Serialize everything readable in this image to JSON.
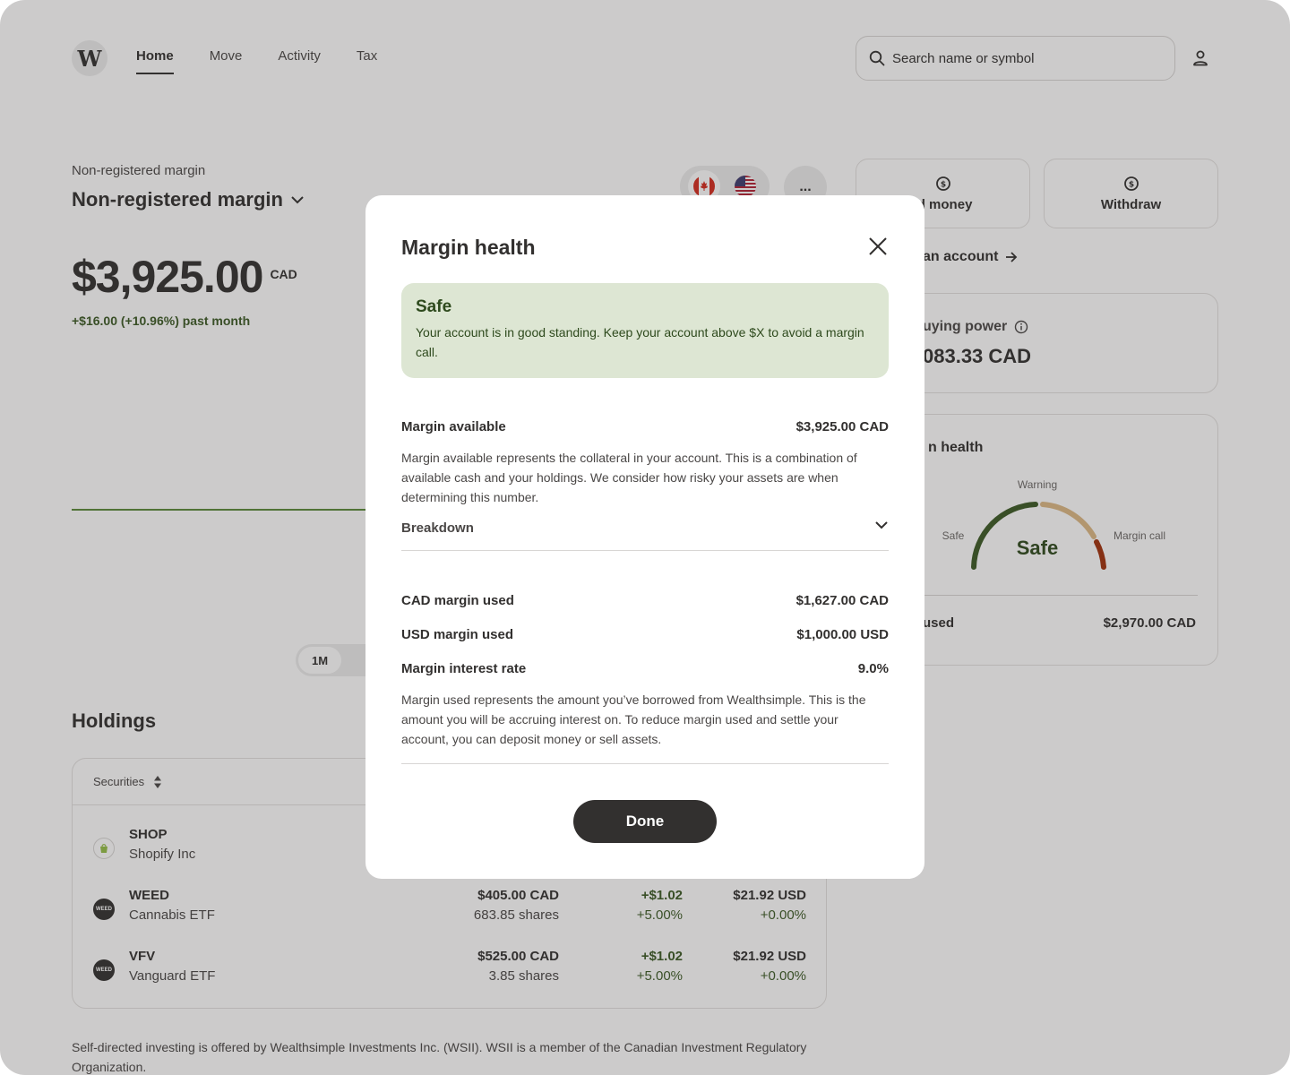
{
  "brand": {
    "logo_letter": "W"
  },
  "nav": {
    "items": [
      {
        "label": "Home",
        "active": true
      },
      {
        "label": "Move",
        "active": false
      },
      {
        "label": "Activity",
        "active": false
      },
      {
        "label": "Tax",
        "active": false
      }
    ]
  },
  "search": {
    "placeholder": "Search name or symbol"
  },
  "account": {
    "label": "Non-registered margin",
    "selected": "Non-registered margin",
    "balance": "$3,925.00",
    "currency": "CAD",
    "change": "+$16.00 (+10.96%) past month",
    "more_label": "..."
  },
  "chart": {
    "range_selected": "1M"
  },
  "holdings": {
    "title": "Holdings",
    "sort_label": "Securities",
    "rows": [
      {
        "symbol": "SHOP",
        "name": "Shopify Inc",
        "value": "",
        "shares": "",
        "change": "",
        "change_pct": "",
        "price": "",
        "price_pct": "",
        "logo_color": "#95BF47"
      },
      {
        "symbol": "WEED",
        "name": "Cannabis ETF",
        "value": "$405.00 CAD",
        "shares": "683.85 shares",
        "change": "+$1.02",
        "change_pct": "+5.00%",
        "price": "$21.92 USD",
        "price_pct": "+0.00%",
        "logo_text": "WEED",
        "logo_color": "#32302F"
      },
      {
        "symbol": "VFV",
        "name": "Vanguard ETF",
        "value": "$525.00 CAD",
        "shares": "3.85 shares",
        "change": "+$1.02",
        "change_pct": "+5.00%",
        "price": "$21.92 USD",
        "price_pct": "+0.00%",
        "logo_text": "WEED",
        "logo_color": "#32302F"
      }
    ]
  },
  "disclaimer": "Self-directed investing is offered by Wealthsimple Investments Inc. (WSII). WSII is a member of the Canadian Investment Regulatory Organization.",
  "right": {
    "add_money": "ld money",
    "withdraw": "Withdraw",
    "open_account": "an account",
    "buying_power_label": "uying power",
    "buying_power_value": "083.33 CAD",
    "margin_health_title": "n health",
    "gauge": {
      "safe": "Safe",
      "warning": "Warning",
      "margin_call": "Margin call",
      "status": "Safe",
      "level": 0.33
    },
    "used_label": "used",
    "used_value": "$2,970.00 CAD"
  },
  "modal": {
    "title": "Margin health",
    "status_title": "Safe",
    "status_text": "Your account is in good standing. Keep your account above $X to avoid a margin call.",
    "margin_available_label": "Margin available",
    "margin_available_value": "$3,925.00 CAD",
    "margin_available_desc": "Margin available represents the collateral in your account. This is a combination of available cash and your holdings. We consider how risky your assets are when determining this number.",
    "breakdown_label": "Breakdown",
    "cad_used_label": "CAD margin used",
    "cad_used_value": "$1,627.00 CAD",
    "usd_used_label": "USD margin used",
    "usd_used_value": "$1,000.00 USD",
    "rate_label": "Margin interest rate",
    "rate_value": "9.0%",
    "used_desc": "Margin used represents the amount you’ve borrowed from Wealthsimple. This is the amount you will be accruing interest on. To reduce margin used and settle your account, you can deposit money or sell assets.",
    "done_label": "Done"
  },
  "colors": {
    "brand_dark": "#32302F",
    "positive": "#3b5a25",
    "safe_bg": "#dde6d3",
    "gauge_safe": "#3b5a25",
    "gauge_warning": "#dcb884",
    "gauge_danger": "#a0310b"
  }
}
